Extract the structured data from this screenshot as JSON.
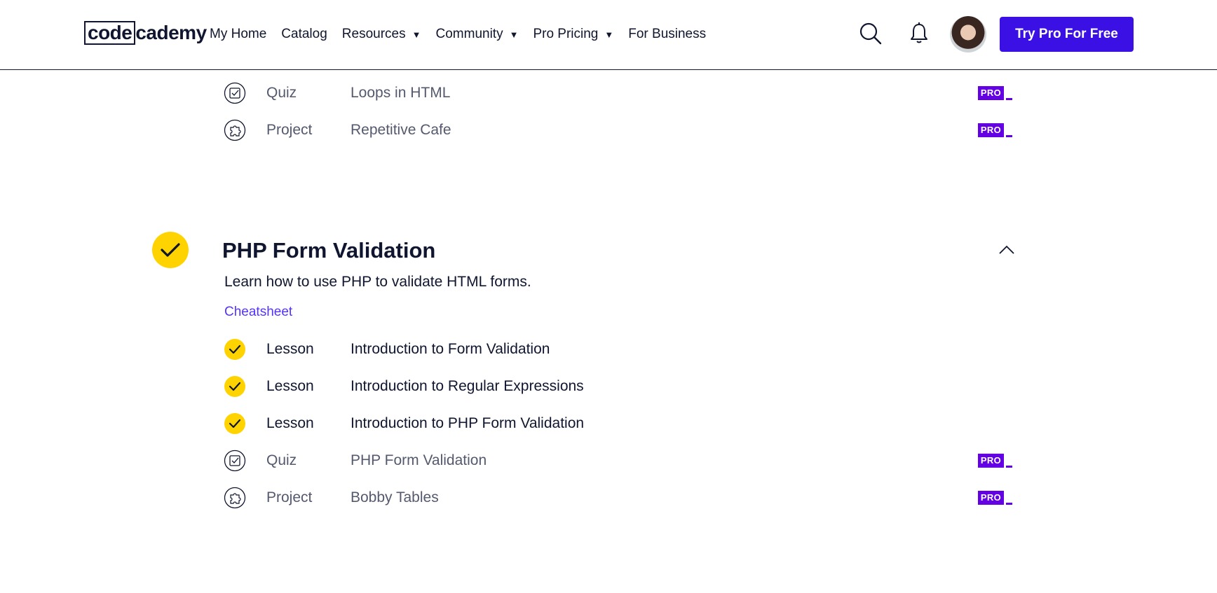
{
  "header": {
    "logo": {
      "boxed": "code",
      "rest": "cademy"
    },
    "nav": [
      {
        "label": "My Home",
        "dropdown": false
      },
      {
        "label": "Catalog",
        "dropdown": false
      },
      {
        "label": "Resources",
        "dropdown": true
      },
      {
        "label": "Community",
        "dropdown": true
      },
      {
        "label": "Pro Pricing",
        "dropdown": true
      },
      {
        "label": "For Business",
        "dropdown": false
      }
    ],
    "caret": "▼",
    "cta_label": "Try Pro For Free",
    "icons": [
      "search-icon",
      "bell-icon",
      "avatar"
    ]
  },
  "prev_module": {
    "items": [
      {
        "type": "Quiz",
        "name": "Loops in HTML",
        "status": "locked",
        "icon": "quiz-icon",
        "badge": "PRO"
      },
      {
        "type": "Project",
        "name": "Repetitive Cafe",
        "status": "locked",
        "icon": "project-icon",
        "badge": "PRO"
      }
    ]
  },
  "module": {
    "title": "PHP Form Validation",
    "completed": true,
    "description": "Learn how to use PHP to validate HTML forms.",
    "cheatsheet_label": "Cheatsheet",
    "items": [
      {
        "type": "Lesson",
        "name": "Introduction to Form Validation",
        "status": "done",
        "icon": "check-icon"
      },
      {
        "type": "Lesson",
        "name": "Introduction to Regular Expressions",
        "status": "done",
        "icon": "check-icon"
      },
      {
        "type": "Lesson",
        "name": "Introduction to PHP Form Validation",
        "status": "done",
        "icon": "check-icon"
      },
      {
        "type": "Quiz",
        "name": "PHP Form Validation",
        "status": "locked",
        "icon": "quiz-icon",
        "badge": "PRO"
      },
      {
        "type": "Project",
        "name": "Bobby Tables",
        "status": "locked",
        "icon": "project-icon",
        "badge": "PRO"
      }
    ]
  },
  "colors": {
    "brand_purple": "#3a10e5",
    "pro_purple": "#6400e4",
    "check_yellow": "#ffd300",
    "text_dark": "#10162f",
    "text_muted": "#55596d",
    "link": "#5533ff"
  }
}
